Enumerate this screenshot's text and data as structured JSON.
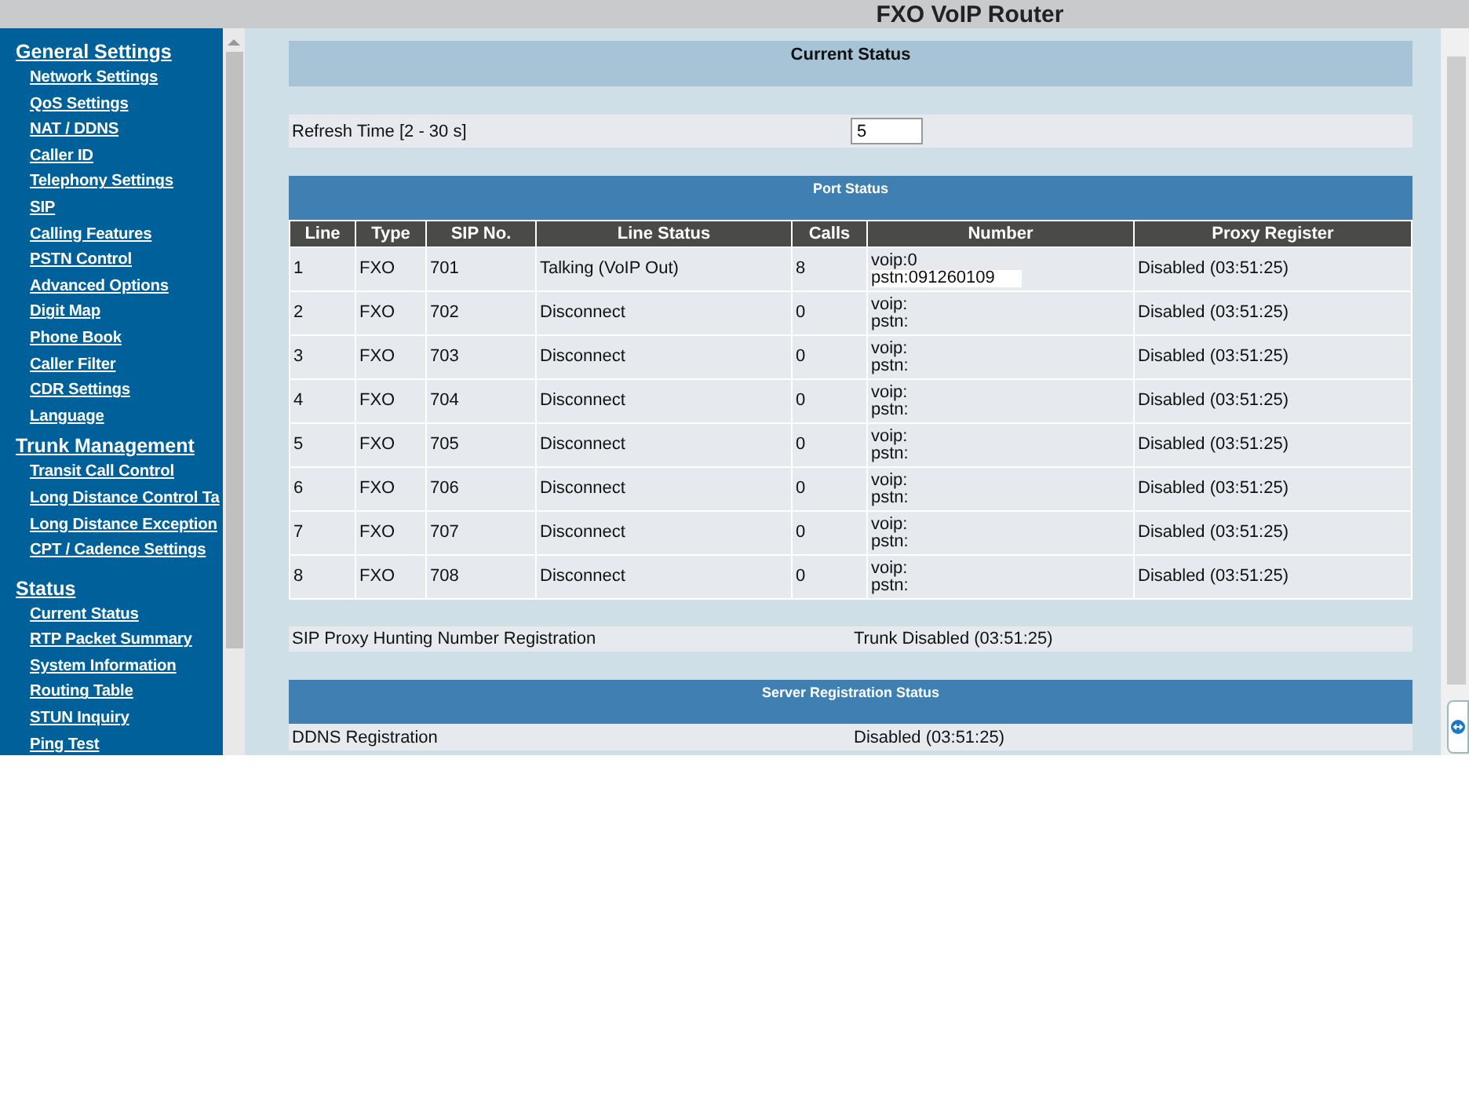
{
  "header": {
    "title": "FXO VoIP Router"
  },
  "sidebar": {
    "sections": [
      {
        "title": "General Settings",
        "items": [
          "Network Settings",
          "QoS Settings",
          "NAT / DDNS",
          "Caller ID",
          "Telephony Settings",
          "SIP",
          "Calling Features",
          "PSTN Control",
          "Advanced Options",
          "Digit Map",
          "Phone Book",
          "Caller Filter",
          "CDR Settings",
          "Language"
        ]
      },
      {
        "title": "Trunk Management",
        "items": [
          "Transit Call Control",
          "Long Distance Control Ta",
          "Long Distance Exception",
          "CPT / Cadence Settings"
        ]
      },
      {
        "title": "Status",
        "items": [
          "Current Status",
          "RTP Packet Summary",
          "System Information",
          "Routing Table",
          "STUN Inquiry",
          "Ping Test"
        ]
      }
    ]
  },
  "page_title": "Current Status",
  "refresh": {
    "label": "Refresh Time [2 - 30 s]",
    "value": "5"
  },
  "port_status": {
    "title": "Port Status",
    "columns": [
      "Line",
      "Type",
      "SIP No.",
      "Line Status",
      "Calls",
      "Number",
      "Proxy Register"
    ],
    "rows": [
      {
        "line": "1",
        "type": "FXO",
        "sip_no": "701",
        "line_status": "Talking (VoIP Out)",
        "calls": "8",
        "number_voip": "voip:0",
        "number_pstn": "pstn:091260109",
        "proxy": "Disabled (03:51:25)"
      },
      {
        "line": "2",
        "type": "FXO",
        "sip_no": "702",
        "line_status": "Disconnect",
        "calls": "0",
        "number_voip": "voip:",
        "number_pstn": "pstn:",
        "proxy": "Disabled (03:51:25)"
      },
      {
        "line": "3",
        "type": "FXO",
        "sip_no": "703",
        "line_status": "Disconnect",
        "calls": "0",
        "number_voip": "voip:",
        "number_pstn": "pstn:",
        "proxy": "Disabled (03:51:25)"
      },
      {
        "line": "4",
        "type": "FXO",
        "sip_no": "704",
        "line_status": "Disconnect",
        "calls": "0",
        "number_voip": "voip:",
        "number_pstn": "pstn:",
        "proxy": "Disabled (03:51:25)"
      },
      {
        "line": "5",
        "type": "FXO",
        "sip_no": "705",
        "line_status": "Disconnect",
        "calls": "0",
        "number_voip": "voip:",
        "number_pstn": "pstn:",
        "proxy": "Disabled (03:51:25)"
      },
      {
        "line": "6",
        "type": "FXO",
        "sip_no": "706",
        "line_status": "Disconnect",
        "calls": "0",
        "number_voip": "voip:",
        "number_pstn": "pstn:",
        "proxy": "Disabled (03:51:25)"
      },
      {
        "line": "7",
        "type": "FXO",
        "sip_no": "707",
        "line_status": "Disconnect",
        "calls": "0",
        "number_voip": "voip:",
        "number_pstn": "pstn:",
        "proxy": "Disabled (03:51:25)"
      },
      {
        "line": "8",
        "type": "FXO",
        "sip_no": "708",
        "line_status": "Disconnect",
        "calls": "0",
        "number_voip": "voip:",
        "number_pstn": "pstn:",
        "proxy": "Disabled (03:51:25)"
      }
    ]
  },
  "hunting": {
    "label": "SIP Proxy Hunting Number Registration",
    "value": "Trunk Disabled (03:51:25)"
  },
  "server_registration": {
    "title": "Server Registration Status",
    "rows": [
      {
        "label": "DDNS Registration",
        "value": "Disabled (03:51:25)"
      }
    ]
  }
}
